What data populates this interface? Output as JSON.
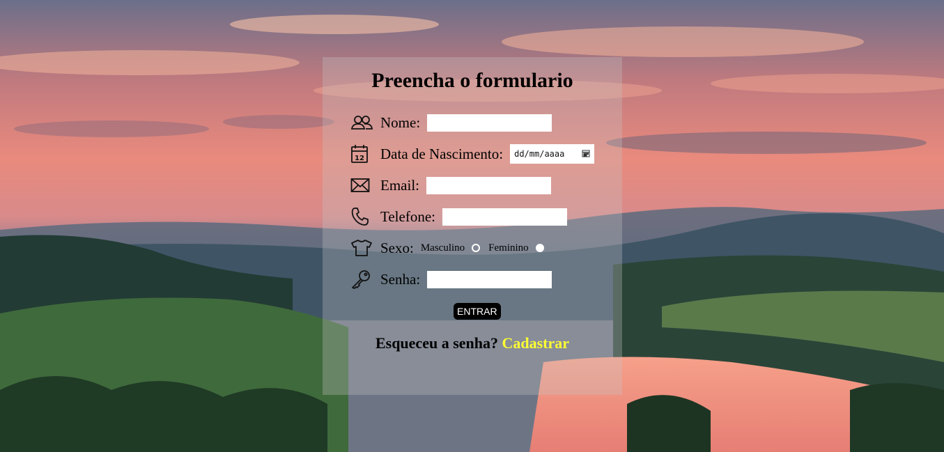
{
  "form": {
    "title": "Preencha o formulario",
    "fields": {
      "nome": {
        "label": "Nome:",
        "value": "",
        "icon": "users-icon"
      },
      "nascimento": {
        "label": "Data de Nascimento:",
        "placeholder": "dd/mm/aaaa",
        "icon": "calendar-icon"
      },
      "email": {
        "label": "Email:",
        "value": "",
        "icon": "envelope-icon"
      },
      "telefone": {
        "label": "Telefone:",
        "value": "",
        "icon": "phone-icon"
      },
      "sexo": {
        "label": "Sexo:",
        "icon": "shirt-icon",
        "options": [
          "Masculino",
          "Feminino"
        ],
        "selected": "Feminino"
      },
      "senha": {
        "label": "Senha:",
        "value": "",
        "icon": "key-icon"
      }
    },
    "submit_label": "ENTRAR",
    "footer_text": "Esqueceu a senha?",
    "footer_link": "Cadastrar",
    "calendar_glyph": "calendar-picker-icon"
  },
  "colors": {
    "card_bg": "#c8c8c84d",
    "link": "#ffff33",
    "button_bg": "#000000",
    "button_text": "#ffffff"
  }
}
